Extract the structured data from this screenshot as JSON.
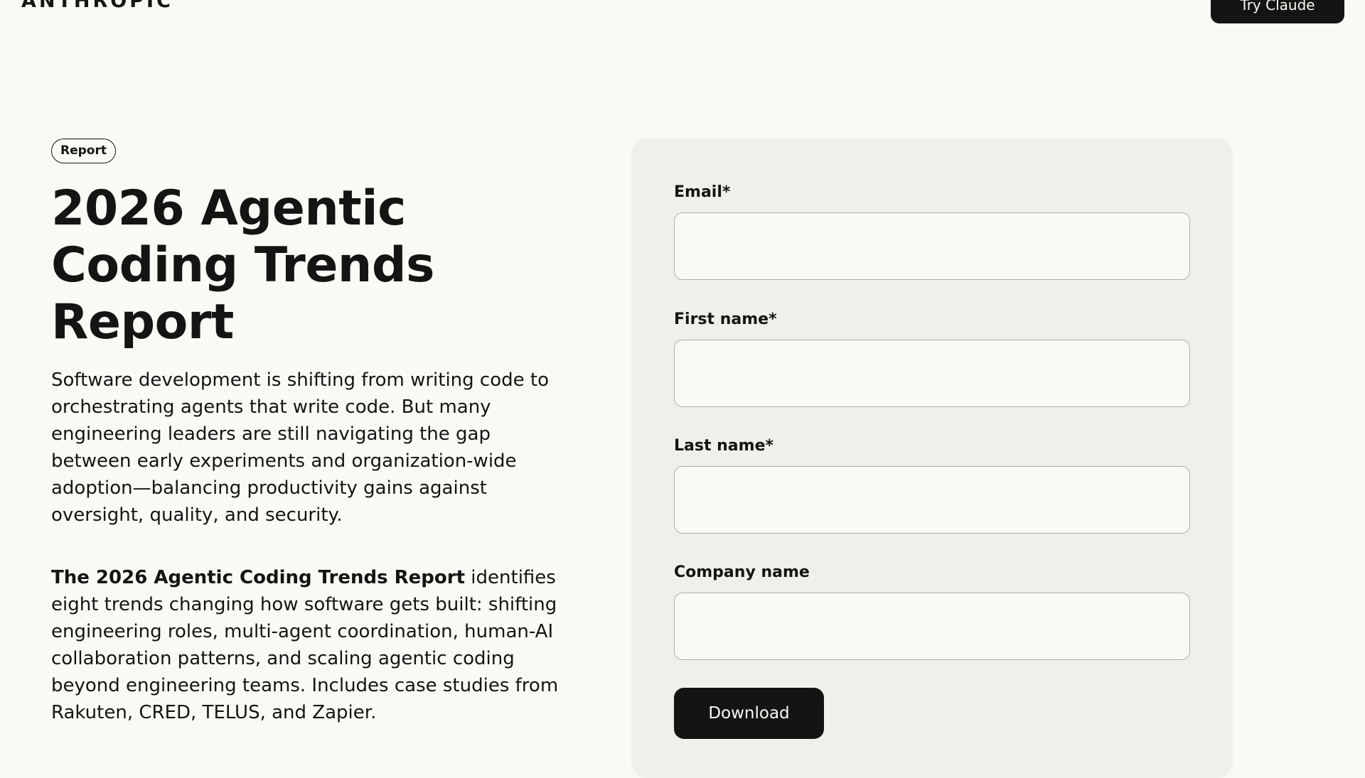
{
  "header": {
    "logo_text": "ANTHROPIC",
    "cta_label": "Try Claude"
  },
  "hero": {
    "badge": "Report",
    "title": "2026 Agentic Coding Trends Report",
    "description": "Software development is shifting from writing code to orchestrating agents that write code. But many engineering leaders are still navigating the gap between early experiments and organization-wide adoption—balancing productivity gains against oversight, quality, and security.",
    "summary_bold": "The 2026 Agentic Coding Trends Report",
    "summary_rest": " identifies eight trends changing how software gets built: shifting engineering roles, multi-agent coordination, human-AI collaboration patterns, and scaling agentic coding beyond engineering teams. Includes case studies from Rakuten, CRED, TELUS, and Zapier."
  },
  "form": {
    "email_label": "Email*",
    "email_value": "",
    "first_name_label": "First name*",
    "first_name_value": "",
    "last_name_label": "Last name*",
    "last_name_value": "",
    "company_label": "Company name",
    "company_value": "",
    "submit_label": "Download"
  }
}
